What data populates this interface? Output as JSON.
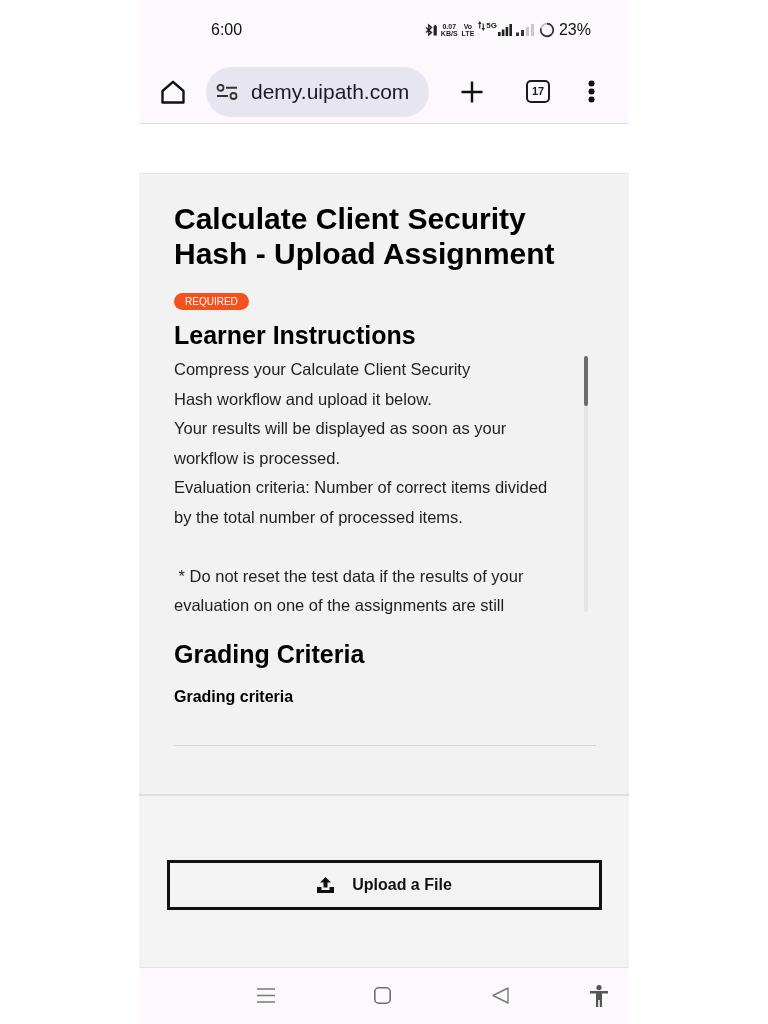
{
  "status_bar": {
    "time": "6:00",
    "data_speed": "0.07",
    "data_speed_unit": "KB/S",
    "volte_top": "Vo",
    "volte_bottom": "LTE",
    "network": "5G",
    "battery": "23%"
  },
  "browser_toolbar": {
    "url": "demy.uipath.com",
    "tab_count": "17"
  },
  "assignment": {
    "title": "Calculate Client Security Hash - Upload Assignment",
    "badge": "REQUIRED",
    "instructions": {
      "heading": "Learner Instructions",
      "paragraphs": [
        {
          "lines": [
            "Compress your Calculate Client Security",
            "Hash workflow and upload it below.",
            "Your results will be displayed as soon as your",
            "workflow is processed.",
            "Evaluation criteria: Number of correct items divided",
            "by the total number of processed items."
          ]
        },
        {
          "lines": [
            " * Do not reset the test data if the results of your",
            "evaluation on one of the assignments are still"
          ]
        }
      ]
    },
    "grading": {
      "heading": "Grading Criteria",
      "text": "Grading criteria"
    }
  },
  "upload_button": {
    "label": "Upload a File"
  }
}
